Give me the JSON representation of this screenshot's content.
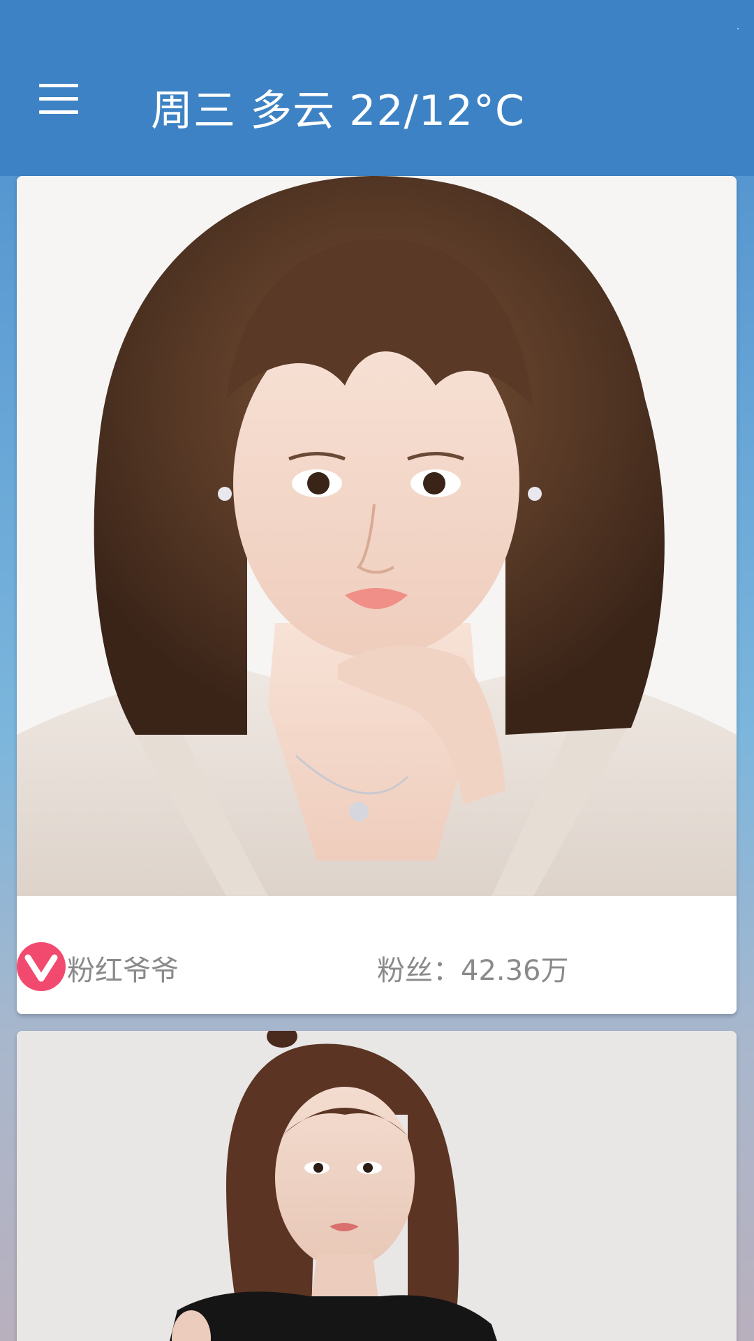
{
  "appbar": {
    "title": "周三 多云 22/12°C",
    "menu_icon": "hamburger-menu-icon",
    "background_color": "#3d82c4"
  },
  "cards": [
    {
      "badge_icon": "v-verified-icon",
      "badge_letter": "V",
      "badge_color": "#f24a6e",
      "author": "粉红爷爷",
      "fans": "粉丝：42.36万"
    },
    {
      "photo": "portrait-photo-dark-top"
    }
  ]
}
